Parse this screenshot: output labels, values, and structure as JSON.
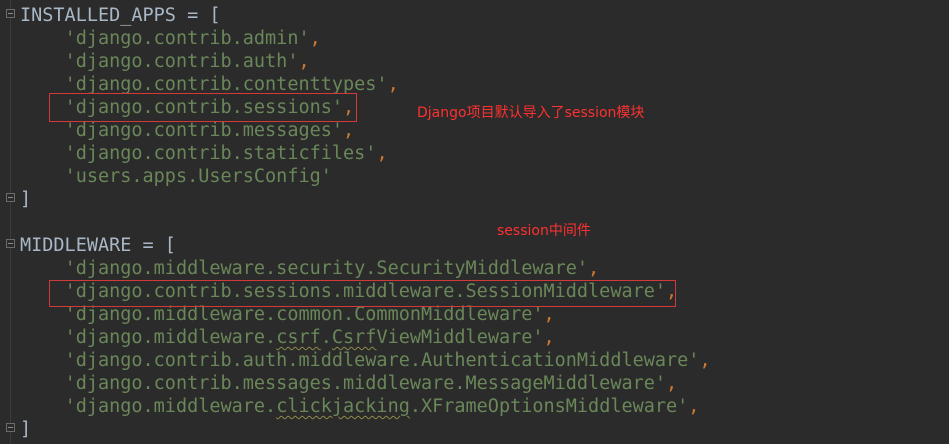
{
  "editor": {
    "installed_apps": {
      "header": "INSTALLED_APPS = [",
      "items": [
        "'django.contrib.admin'",
        "'django.contrib.auth'",
        "'django.contrib.contenttypes'",
        "'django.contrib.sessions'",
        "'django.contrib.messages'",
        "'django.contrib.staticfiles'",
        "'users.apps.UsersConfig'"
      ],
      "close": "]"
    },
    "middleware": {
      "header": "MIDDLEWARE = [",
      "items": [
        "'django.middleware.security.SecurityMiddleware'",
        "'django.contrib.sessions.middleware.SessionMiddleware'",
        "'django.middleware.common.CommonMiddleware'",
        "'django.middleware.",
        "csrf",
        ".",
        "Csrf",
        "ViewMiddleware'",
        "'django.contrib.auth.middleware.AuthenticationMiddleware'",
        "'django.contrib.messages.middleware.MessageMiddleware'",
        "'django.middleware.",
        "clickjacking",
        ".XFrameOptionsMiddleware'"
      ],
      "close": "]"
    },
    "comma": ","
  },
  "annotations": {
    "session_module": "Django项目默认导入了session模块",
    "session_middleware": "session中间件"
  },
  "colors": {
    "background": "#2b2b2b",
    "string": "#6a8759",
    "identifier": "#a9b7c6",
    "punctuation": "#cc7832",
    "annotation": "#ff3030",
    "highlight_border": "#d23a3a"
  }
}
